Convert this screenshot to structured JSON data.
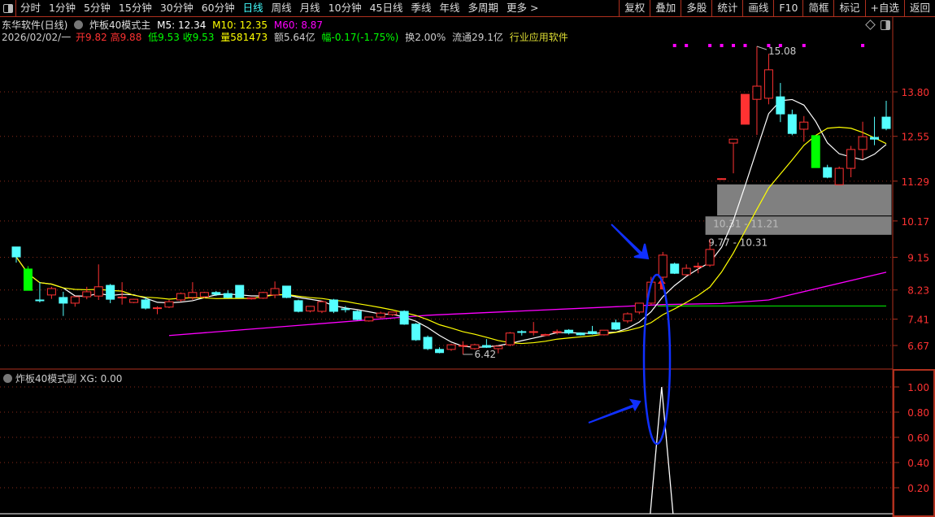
{
  "toolbar": {
    "periods": [
      "分时",
      "1分钟",
      "5分钟",
      "15分钟",
      "30分钟",
      "60分钟",
      "日线",
      "周线",
      "月线",
      "10分钟",
      "45日线",
      "季线",
      "年线",
      "多周期",
      "更多 >"
    ],
    "active": "日线",
    "tools": [
      "复权",
      "叠加",
      "多股",
      "统计",
      "画线",
      "F10",
      "简框",
      "标记",
      "+自选",
      "返回"
    ]
  },
  "header": {
    "stock": "东华软件(日线)",
    "indicator": "炸板40模式主",
    "m5": "M5: 12.34",
    "m10": "M10: 12.35",
    "m60": "M60: 8.87",
    "date": "2026/02/02/一",
    "open": "开9.82",
    "high": "高9.88",
    "low": "低9.53",
    "close": "收9.53",
    "volume": "量581473",
    "amount": "额5.64亿",
    "change": "幅-0.17(-1.75%)",
    "turnover": "换2.00%",
    "float": "流通29.1亿",
    "industry": "行业应用软件"
  },
  "sub_header": {
    "indicator": "炸板40模式副",
    "xg": "XG: 0.00"
  },
  "colors": {
    "up": "#ff3232",
    "down": "#54ffff",
    "ma5": "#ffffff",
    "ma10": "#ffff00",
    "ma60": "#ff00ff",
    "limit_down": "#00ff00",
    "axis": "#ff3232",
    "annotation": "#1030ff"
  },
  "chart_data": [
    {
      "type": "candlestick",
      "ylim": [
        6.3,
        15.3
      ],
      "yticks": [
        "13.80",
        "12.55",
        "11.29",
        "10.17",
        "9.15",
        "8.23",
        "7.41",
        "6.67"
      ],
      "candles_ohlc": [
        [
          9.44,
          9.44,
          9.0,
          9.16
        ],
        [
          8.82,
          8.9,
          8.22,
          8.22
        ],
        [
          7.95,
          8.45,
          7.88,
          7.93
        ],
        [
          8.09,
          8.32,
          7.98,
          8.27
        ],
        [
          8.02,
          8.18,
          7.5,
          7.86
        ],
        [
          7.86,
          8.06,
          7.76,
          8.04
        ],
        [
          8.04,
          8.32,
          7.97,
          8.18
        ],
        [
          8.06,
          8.95,
          7.95,
          8.32
        ],
        [
          8.36,
          8.4,
          7.86,
          7.97
        ],
        [
          8.02,
          8.45,
          7.82,
          8.03
        ],
        [
          7.88,
          7.98,
          7.86,
          7.97
        ],
        [
          7.95,
          8.03,
          7.68,
          7.72
        ],
        [
          7.72,
          7.77,
          7.55,
          7.73
        ],
        [
          7.75,
          7.95,
          7.72,
          7.9
        ],
        [
          7.95,
          8.16,
          7.9,
          8.13
        ],
        [
          8.02,
          8.45,
          7.95,
          8.16
        ],
        [
          8.04,
          8.18,
          8.0,
          8.16
        ],
        [
          8.16,
          8.2,
          8.06,
          8.11
        ],
        [
          8.13,
          8.22,
          8.0,
          8.02
        ],
        [
          8.36,
          8.36,
          8.02,
          8.02
        ],
        [
          7.98,
          8.02,
          7.96,
          8.01
        ],
        [
          8.0,
          8.18,
          7.98,
          8.16
        ],
        [
          8.09,
          8.47,
          8.0,
          8.27
        ],
        [
          8.34,
          8.34,
          8.0,
          8.02
        ],
        [
          7.93,
          7.96,
          7.6,
          7.63
        ],
        [
          7.64,
          7.78,
          7.6,
          7.77
        ],
        [
          7.63,
          7.93,
          7.58,
          7.9
        ],
        [
          7.95,
          7.98,
          7.58,
          7.63
        ],
        [
          7.7,
          7.78,
          7.6,
          7.69
        ],
        [
          7.63,
          7.66,
          7.38,
          7.4
        ],
        [
          7.36,
          7.48,
          7.34,
          7.47
        ],
        [
          7.47,
          7.62,
          7.44,
          7.58
        ],
        [
          7.54,
          7.62,
          7.5,
          7.61
        ],
        [
          7.63,
          7.66,
          7.25,
          7.27
        ],
        [
          7.27,
          7.3,
          6.8,
          6.83
        ],
        [
          6.9,
          6.95,
          6.54,
          6.58
        ],
        [
          6.56,
          6.62,
          6.45,
          6.47
        ],
        [
          6.56,
          6.72,
          6.52,
          6.69
        ],
        [
          6.66,
          6.79,
          6.42,
          6.67
        ],
        [
          6.58,
          6.72,
          6.55,
          6.69
        ],
        [
          6.67,
          6.85,
          6.6,
          6.62
        ],
        [
          6.58,
          6.66,
          6.45,
          6.65
        ],
        [
          6.69,
          7.05,
          6.65,
          7.02
        ],
        [
          7.06,
          7.1,
          6.95,
          7.04
        ],
        [
          7.06,
          7.33,
          6.95,
          7.06
        ],
        [
          6.95,
          7.0,
          6.93,
          6.98
        ],
        [
          7.06,
          7.12,
          6.98,
          7.06
        ],
        [
          7.1,
          7.13,
          6.98,
          7.02
        ],
        [
          7.02,
          7.04,
          6.95,
          6.97
        ],
        [
          7.06,
          7.22,
          6.98,
          7.0
        ],
        [
          6.97,
          7.1,
          6.95,
          7.1
        ],
        [
          7.31,
          7.4,
          7.1,
          7.13
        ],
        [
          7.36,
          7.6,
          7.3,
          7.56
        ],
        [
          7.61,
          7.86,
          7.55,
          7.86
        ],
        [
          7.86,
          8.6,
          7.8,
          8.45
        ],
        [
          8.59,
          9.3,
          8.5,
          9.21
        ],
        [
          8.96,
          9.0,
          8.68,
          8.7
        ],
        [
          8.66,
          8.95,
          8.62,
          8.84
        ],
        [
          8.89,
          9.0,
          8.7,
          8.9
        ],
        [
          8.93,
          9.65,
          8.88,
          9.37
        ],
        [
          11.35,
          11.37,
          11.35,
          11.36
        ],
        [
          12.36,
          12.47,
          11.51,
          12.47
        ],
        [
          12.89,
          13.73,
          12.89,
          13.73
        ],
        [
          13.59,
          15.08,
          12.59,
          13.96
        ],
        [
          13.62,
          14.87,
          13.45,
          14.42
        ],
        [
          13.66,
          14.05,
          12.95,
          13.18
        ],
        [
          13.16,
          13.3,
          12.58,
          12.63
        ],
        [
          12.75,
          13.12,
          12.4,
          12.95
        ],
        [
          12.57,
          12.57,
          11.67,
          11.67
        ],
        [
          11.67,
          11.75,
          11.37,
          11.4
        ],
        [
          11.19,
          11.7,
          11.19,
          11.65
        ],
        [
          11.65,
          12.28,
          11.4,
          12.18
        ],
        [
          12.18,
          12.96,
          11.91,
          12.54
        ],
        [
          12.52,
          13.1,
          12.3,
          12.47
        ],
        [
          13.09,
          13.55,
          12.72,
          12.77
        ]
      ],
      "limit_up_filled": [
        62
      ],
      "limit_down_filled": [
        1,
        68
      ],
      "ma60_points": [
        [
          13,
          6.95
        ],
        [
          35,
          7.52
        ],
        [
          55,
          7.82
        ],
        [
          60,
          7.85
        ],
        [
          64,
          7.95
        ],
        [
          74,
          8.73
        ]
      ],
      "support_line": {
        "value": 7.78,
        "from": 54
      },
      "zones": [
        {
          "low": 10.31,
          "high": 11.21,
          "label": "10.31 - 11.21",
          "from": 60
        },
        {
          "low": 9.77,
          "high": 10.31,
          "label": "9.77 - 10.31",
          "from": 59
        }
      ],
      "high_label": {
        "index": 63,
        "value": "15.08"
      },
      "low_label": {
        "index": 38,
        "value": "6.42"
      },
      "signal_marker_index": 54,
      "top_dots": [
        56,
        57,
        59,
        60,
        61,
        62,
        64,
        65,
        67,
        72
      ]
    },
    {
      "type": "line",
      "series": [
        {
          "name": "XG",
          "signal_index": 54,
          "value": 1.0
        }
      ],
      "ylim": [
        0,
        1.1
      ],
      "yticks": [
        "1.00",
        "0.80",
        "0.60",
        "0.40",
        "0.20"
      ]
    }
  ]
}
